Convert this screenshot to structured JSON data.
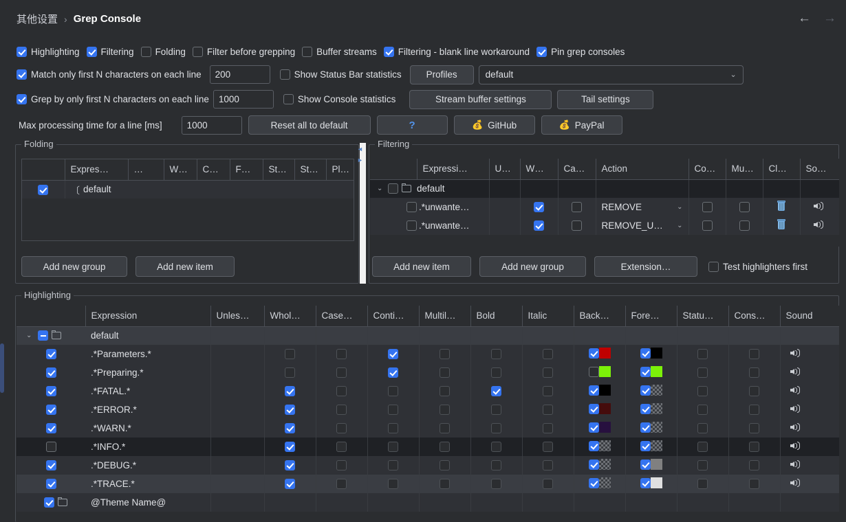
{
  "header": {
    "breadcrumb_root": "其他设置",
    "breadcrumb_sep": "›",
    "breadcrumb_leaf": "Grep Console",
    "back_arrow": "←",
    "forward_arrow": "→"
  },
  "options": {
    "row1": [
      {
        "label": "Highlighting",
        "checked": true
      },
      {
        "label": "Filtering",
        "checked": true
      },
      {
        "label": "Folding",
        "checked": false
      },
      {
        "label": "Filter before grepping",
        "checked": false
      },
      {
        "label": "Buffer streams",
        "checked": false
      },
      {
        "label": "Filtering - blank line workaround",
        "checked": true
      },
      {
        "label": "Pin grep consoles",
        "checked": true
      }
    ],
    "row2": {
      "match_label": "Match only first N characters on each line",
      "match_checked": true,
      "match_value": "200",
      "status_bar_label": "Show Status Bar statistics",
      "status_bar_checked": false,
      "profiles_button": "Profiles",
      "profile_selected": "default",
      "profile_caret": "⌄"
    },
    "row3": {
      "grep_label": "Grep by only first N characters on each line",
      "grep_checked": true,
      "grep_value": "1000",
      "console_stats_label": "Show Console statistics",
      "console_stats_checked": false,
      "stream_buffer_button": "Stream buffer settings",
      "tail_button": "Tail settings"
    },
    "row4": {
      "max_time_label": "Max processing time for a line [ms]",
      "max_time_value": "1000",
      "reset_button": "Reset all to default",
      "help_button": "?",
      "github_button": "GitHub",
      "paypal_button": "PayPal",
      "github_icon": "coin-hand-icon",
      "paypal_icon": "coin-hand-icon"
    }
  },
  "folding": {
    "legend": "Folding",
    "columns": [
      "",
      "Expres…",
      "…",
      "W…",
      "C…",
      "F…",
      "St…",
      "St…",
      "Pl…"
    ],
    "rows": [
      {
        "checked": true,
        "bracket": "〔",
        "name": "default"
      }
    ],
    "buttons": [
      "Add new group",
      "Add new item"
    ]
  },
  "filtering": {
    "legend": "Filtering",
    "columns": [
      "",
      "Expressi…",
      "U…",
      "W…",
      "Ca…",
      "Action",
      "Co…",
      "Mu…",
      "Cl…",
      "So…"
    ],
    "rows": [
      {
        "type": "group",
        "twisty": "⌄",
        "checked": false,
        "icon": "folder-icon",
        "expression": "default",
        "unless": null,
        "whole": null,
        "case": null,
        "action": null,
        "cont": null,
        "multi": null,
        "clear": null,
        "sound": null
      },
      {
        "type": "item",
        "checked": false,
        "expression": ".*unwante…",
        "unless": false,
        "whole": true,
        "case": false,
        "action": "REMOVE",
        "cont": false,
        "multi": false,
        "clear": "trash-icon",
        "sound": "speaker-icon"
      },
      {
        "type": "item",
        "checked": false,
        "expression": ".*unwante…",
        "unless": false,
        "whole": true,
        "case": false,
        "action": "REMOVE_U…",
        "cont": false,
        "multi": false,
        "clear": "trash-icon",
        "sound": "speaker-icon"
      }
    ],
    "buttons": [
      "Add new item",
      "Add new group",
      "Extension…"
    ],
    "test_highlighters_label": "Test highlighters first",
    "test_highlighters_checked": false
  },
  "highlighting": {
    "legend": "Highlighting",
    "columns": [
      "",
      "Expression",
      "Unles…",
      "Whol…",
      "Case…",
      "Conti…",
      "Multil…",
      "Bold",
      "Italic",
      "Back…",
      "Fore…",
      "Statu…",
      "Cons…",
      "Sound"
    ],
    "rows": [
      {
        "type": "group",
        "twisty": "⌄",
        "state": "mixed",
        "icon": "folder-icon",
        "expression": "default",
        "rowstyle": "row-c"
      },
      {
        "type": "item",
        "checked": true,
        "expression": ".*Parameters.*",
        "whole": false,
        "case": false,
        "cont": true,
        "multi": false,
        "bold": false,
        "italic": false,
        "back_checked": true,
        "back_color": "#c00000",
        "fore_checked": true,
        "fore_color": "#000000",
        "status": false,
        "console": false,
        "sound": "speaker-icon",
        "rowstyle": "row-a"
      },
      {
        "type": "item",
        "checked": true,
        "expression": ".*Preparing.*",
        "whole": false,
        "case": false,
        "cont": true,
        "multi": false,
        "bold": false,
        "italic": false,
        "back_checked": false,
        "back_color": "#7cf109",
        "fore_checked": true,
        "fore_color": "#7cf109",
        "status": false,
        "console": false,
        "sound": "speaker-icon",
        "rowstyle": "row-a"
      },
      {
        "type": "item",
        "checked": true,
        "expression": ".*FATAL.*",
        "whole": true,
        "case": false,
        "cont": false,
        "multi": false,
        "bold": true,
        "italic": false,
        "back_checked": true,
        "back_color": "#000000",
        "fore_checked": true,
        "fore_color": "checker",
        "status": false,
        "console": false,
        "sound": "speaker-icon",
        "rowstyle": "row-a"
      },
      {
        "type": "item",
        "checked": true,
        "expression": ".*ERROR.*",
        "whole": true,
        "case": false,
        "cont": false,
        "multi": false,
        "bold": false,
        "italic": false,
        "back_checked": true,
        "back_color": "#450c0c",
        "fore_checked": true,
        "fore_color": "checker",
        "status": false,
        "console": false,
        "sound": "speaker-icon",
        "rowstyle": "row-a"
      },
      {
        "type": "item",
        "checked": true,
        "expression": ".*WARN.*",
        "whole": true,
        "case": false,
        "cont": false,
        "multi": false,
        "bold": false,
        "italic": false,
        "back_checked": true,
        "back_color": "#27103f",
        "fore_checked": true,
        "fore_color": "checker",
        "status": false,
        "console": false,
        "sound": "speaker-icon",
        "rowstyle": "row-a"
      },
      {
        "type": "item",
        "checked": false,
        "expression": ".*INFO.*",
        "whole": true,
        "case": false,
        "cont": false,
        "multi": false,
        "bold": false,
        "italic": false,
        "back_checked": true,
        "back_color": "checker",
        "fore_checked": true,
        "fore_color": "checker",
        "status": false,
        "console": false,
        "sound": "speaker-icon",
        "rowstyle": "row-b"
      },
      {
        "type": "item",
        "checked": true,
        "expression": ".*DEBUG.*",
        "whole": true,
        "case": false,
        "cont": false,
        "multi": false,
        "bold": false,
        "italic": false,
        "back_checked": true,
        "back_color": "checker",
        "fore_checked": true,
        "fore_color": "#808080",
        "status": false,
        "console": false,
        "sound": "speaker-icon",
        "rowstyle": "row-a"
      },
      {
        "type": "item",
        "checked": true,
        "expression": ".*TRACE.*",
        "whole": true,
        "case": false,
        "cont": false,
        "multi": false,
        "bold": false,
        "italic": false,
        "back_checked": true,
        "back_color": "checker",
        "fore_checked": true,
        "fore_color": "#e0e0e0",
        "status": false,
        "console": false,
        "sound": "speaker-icon",
        "rowstyle": "row-c"
      },
      {
        "type": "group",
        "twisty": "",
        "state": "on",
        "icon": "folder-icon",
        "expression": "@Theme Name@",
        "rowstyle": "row-a"
      }
    ]
  },
  "colors": {
    "accent": "#3574f0",
    "background": "#2b2d30",
    "text": "#dfe1e5",
    "link": "#5394ec"
  }
}
